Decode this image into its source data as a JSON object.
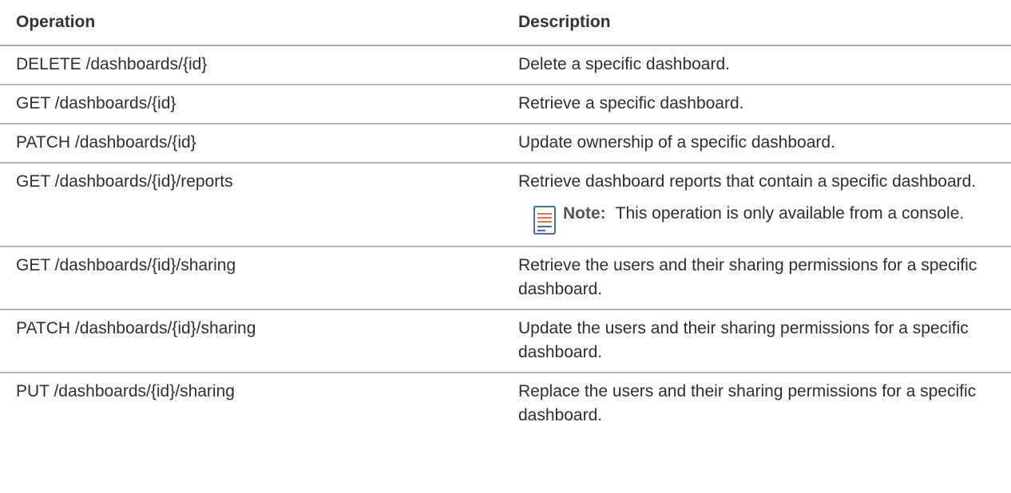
{
  "table": {
    "headers": {
      "operation": "Operation",
      "description": "Description"
    },
    "rows": [
      {
        "operation": "DELETE /dashboards/{id}",
        "description": "Delete a specific dashboard."
      },
      {
        "operation": "GET /dashboards/{id}",
        "description": "Retrieve a specific dashboard."
      },
      {
        "operation": "PATCH /dashboards/{id}",
        "description": "Update ownership of a specific dashboard."
      },
      {
        "operation": "GET /dashboards/{id}/reports",
        "description": "Retrieve dashboard reports that contain a specific dashboard.",
        "note": {
          "label": "Note:",
          "text": "This operation is only available from a console.",
          "icon": "note-icon"
        }
      },
      {
        "operation": "GET /dashboards/{id}/sharing",
        "description": "Retrieve the users and their sharing permissions for a specific dashboard."
      },
      {
        "operation": "PATCH /dashboards/{id}/sharing",
        "description": "Update the users and their sharing permissions for a specific dashboard."
      },
      {
        "operation": "PUT /dashboards/{id}/sharing",
        "description": "Replace the users and their sharing permissions for a specific dashboard."
      }
    ]
  },
  "colors": {
    "note_icon_stroke": "#4a6fa5",
    "note_icon_accent": "#e8734a"
  }
}
